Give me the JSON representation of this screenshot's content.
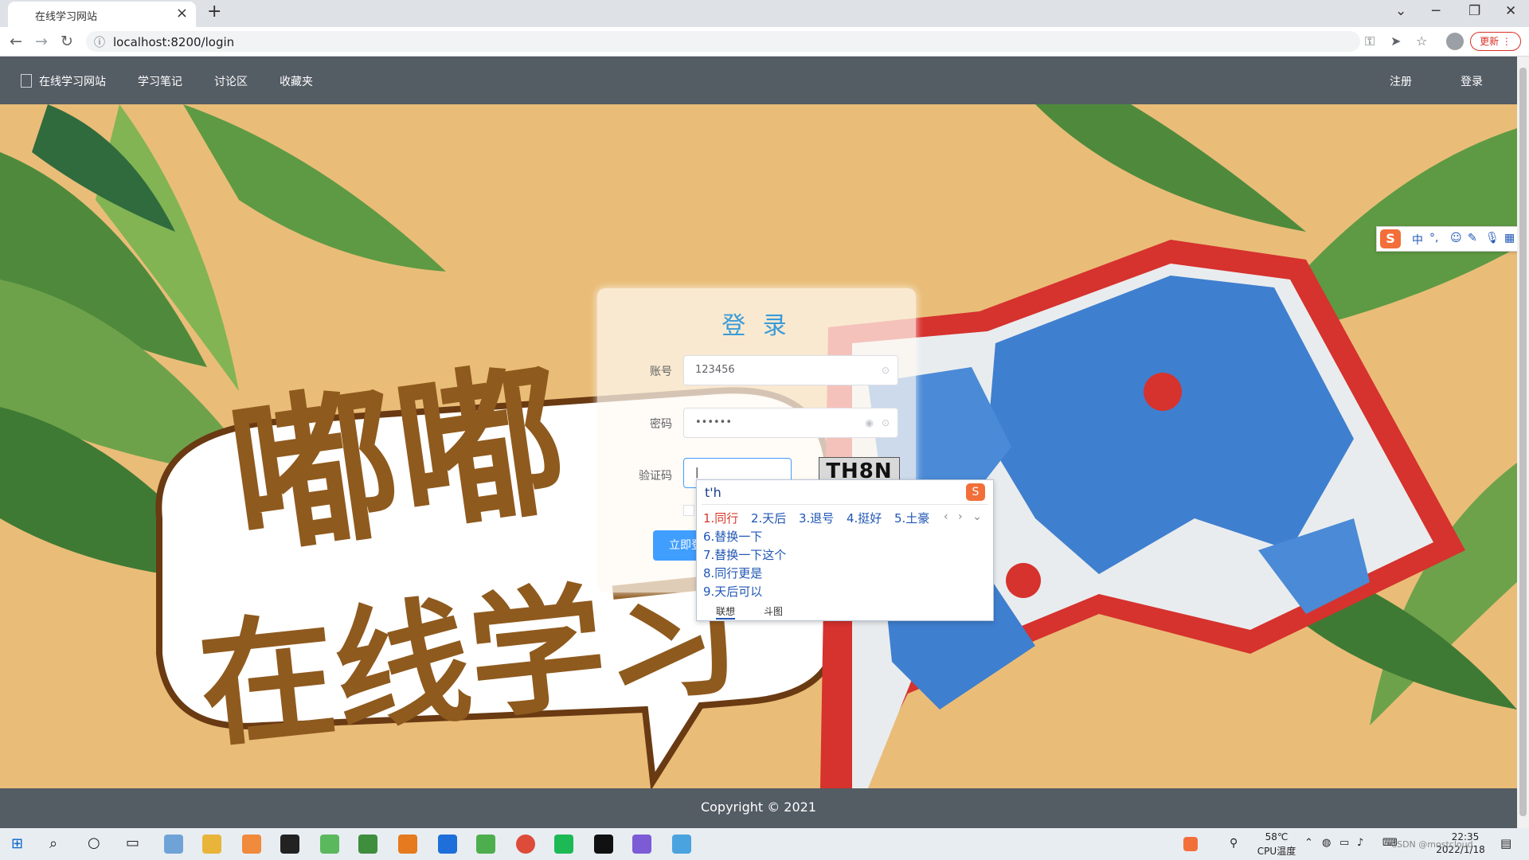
{
  "browser": {
    "tab_title": "在线学习网站",
    "tab_close": "×",
    "new_tab": "+",
    "url": "localhost:8200/login",
    "update_label": "更新"
  },
  "header": {
    "brand": "在线学习网站",
    "nav": [
      "学习笔记",
      "讨论区",
      "收藏夹"
    ],
    "register": "注册",
    "login": "登录"
  },
  "hero": {
    "line1": "嘟嘟",
    "line2": "在线学习"
  },
  "login_form": {
    "title": "登 录",
    "account_label": "账号",
    "account_value": "123456",
    "password_label": "密码",
    "password_value": "••••••",
    "captcha_label": "验证码",
    "captcha_value": "",
    "captcha_image_text": "TH8N",
    "submit_label": "立即登"
  },
  "ime": {
    "composition": "t'h",
    "candidates_row": [
      {
        "label": "1.同行"
      },
      {
        "label": "2.天后"
      },
      {
        "label": "3.退号"
      },
      {
        "label": "4.挺好"
      },
      {
        "label": "5.土豪"
      }
    ],
    "candidates_list": [
      {
        "label": "6.替换一下"
      },
      {
        "label": "7.替换一下这个"
      },
      {
        "label": "8.同行更是"
      },
      {
        "label": "9.天后可以"
      }
    ],
    "tabs": [
      "联想",
      "斗图"
    ],
    "toolbar": {
      "lang": "中",
      "punct": "°,"
    }
  },
  "footer": {
    "copyright": "Copyright © 2021"
  },
  "taskbar": {
    "temp": "58℃",
    "temp_label": "CPU温度",
    "time": "22:35",
    "date": "2022/1/18",
    "watermark": "CSDN @mostcloud"
  },
  "colors": {
    "header_bg": "#545c64",
    "accent": "#409eff",
    "hero_bg": "#e9bd78",
    "map_border": "#d6322e",
    "map_ocean": "#3f7fcf",
    "hero_text": "#8f5a1e"
  }
}
